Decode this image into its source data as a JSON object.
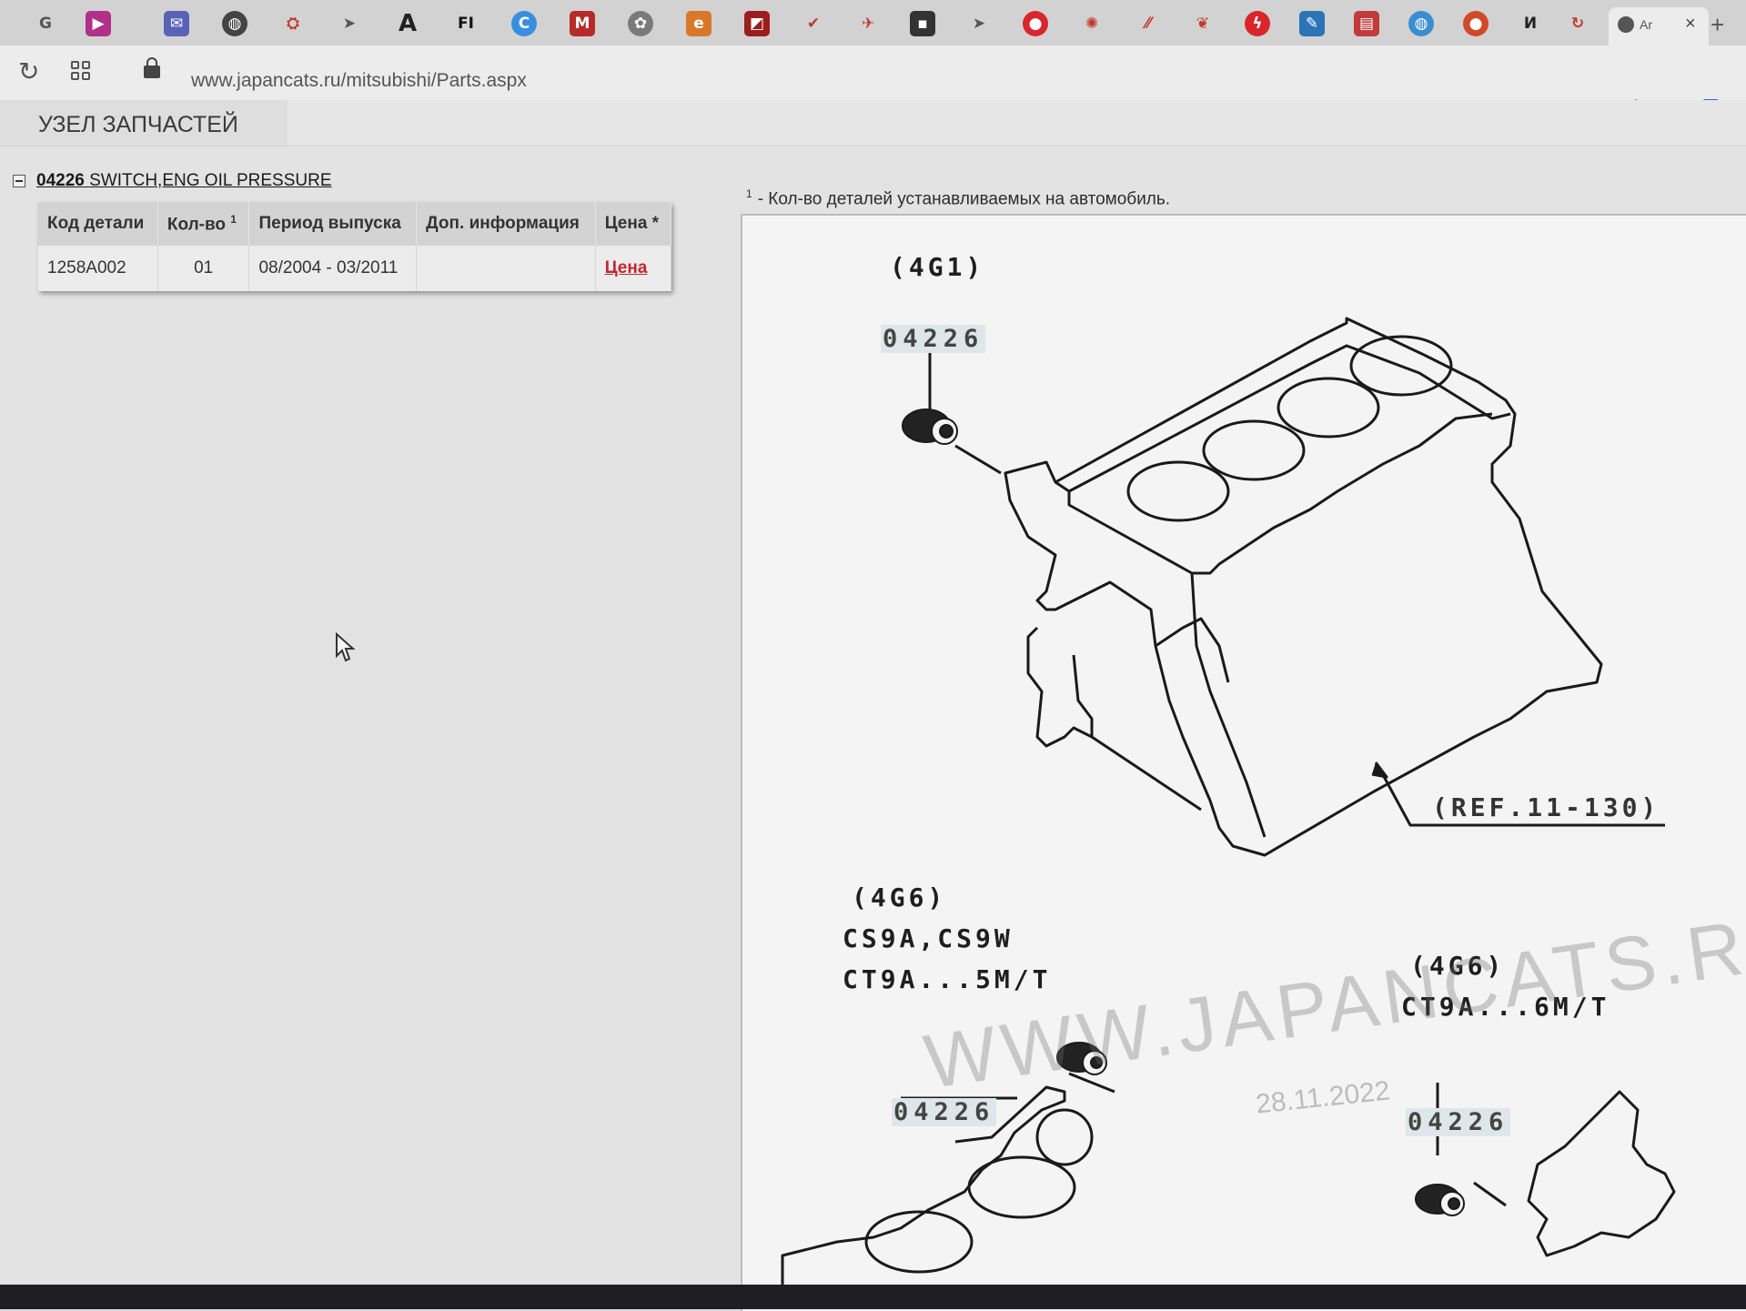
{
  "browser": {
    "active_tab_label": "Ar",
    "url": "www.japancats.ru/mitsubishi/Parts.aspx"
  },
  "page": {
    "heading": "УЗЕЛ ЗАПЧАСТЕЙ",
    "part_code": "04226",
    "part_name": "SWITCH,ENG OIL PRESSURE",
    "table": {
      "headers": [
        "Код детали",
        "Кол-во",
        "Период выпуска",
        "Доп. информация",
        "Цена *"
      ],
      "qty_sup": "1",
      "row": {
        "code": "1258A002",
        "qty": "01",
        "period": "08/2004 - 03/2011",
        "info": "",
        "price_link": "Цена"
      }
    },
    "footnote_mark": "1",
    "footnote": "- Кол-во деталей устанавливаемых на автомобиль."
  },
  "diagram": {
    "engine_4g1": "(4G1)",
    "callout_1": "04226",
    "ref": "(REF.11-130)",
    "engine_4g6_a": "(4G6)",
    "models_a_line1": "CS9A,CS9W",
    "models_a_line2": "CT9A...5M/T",
    "callout_2": "04226",
    "engine_4g6_b": "(4G6)",
    "models_b": "CT9A...6M/T",
    "callout_3": "04226",
    "watermark": "WWW.JAPANCATS.RU",
    "watermark_date": "28.11.2022"
  }
}
